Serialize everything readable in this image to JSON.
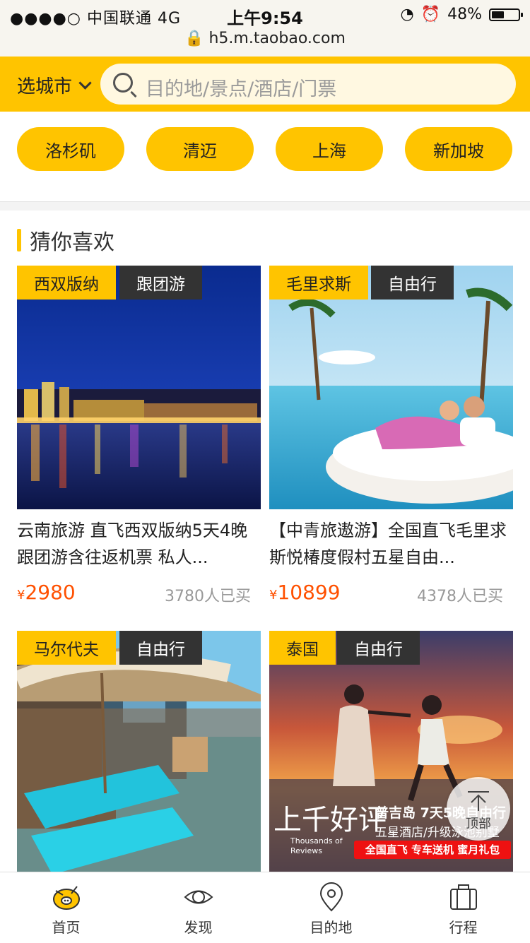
{
  "status": {
    "carrier": "●●●●○ 中国联通   4G",
    "time": "上午9:54",
    "battery": "48%",
    "battery_level": 0.48,
    "url": "h5.m.taobao.com"
  },
  "header": {
    "city": "选城市",
    "search_placeholder": "目的地/景点/酒店/门票"
  },
  "hot_cities": [
    "洛杉矶",
    "清迈",
    "上海",
    "新加坡"
  ],
  "section": {
    "title": "猜你喜欢"
  },
  "cards": [
    {
      "tag1": "西双版纳",
      "tag2": "跟团游",
      "title": "云南旅游 直飞西双版纳5天4晚跟团游含往返机票 私人...",
      "price_symbol": "¥",
      "price": "2980",
      "sold": "3780人已买"
    },
    {
      "tag1": "毛里求斯",
      "tag2": "自由行",
      "title": "【中青旅遨游】全国直飞毛里求斯悦椿度假村五星自由...",
      "price_symbol": "¥",
      "price": "10899",
      "sold": "4378人已买"
    },
    {
      "tag1": "马尔代夫",
      "tag2": "自由行"
    },
    {
      "tag1": "泰国",
      "tag2": "自由行",
      "overlay": {
        "line1": "上千好评",
        "line2": "Thousands of",
        "line3": "Reviews",
        "line4": "普吉岛 7天5晚自由行",
        "line5": "五星酒店/升级泳池别墅",
        "line6": "全国直飞 专车送机 蜜月礼包"
      }
    }
  ],
  "to_top": "顶部",
  "tabbar": [
    {
      "label": "首页",
      "icon": "home-icon"
    },
    {
      "label": "发现",
      "icon": "eye-icon"
    },
    {
      "label": "目的地",
      "icon": "location-pin-icon"
    },
    {
      "label": "行程",
      "icon": "suitcase-icon"
    }
  ],
  "colors": {
    "accent": "#ffc400",
    "price": "#ff5000",
    "dark_tag": "#333333"
  }
}
